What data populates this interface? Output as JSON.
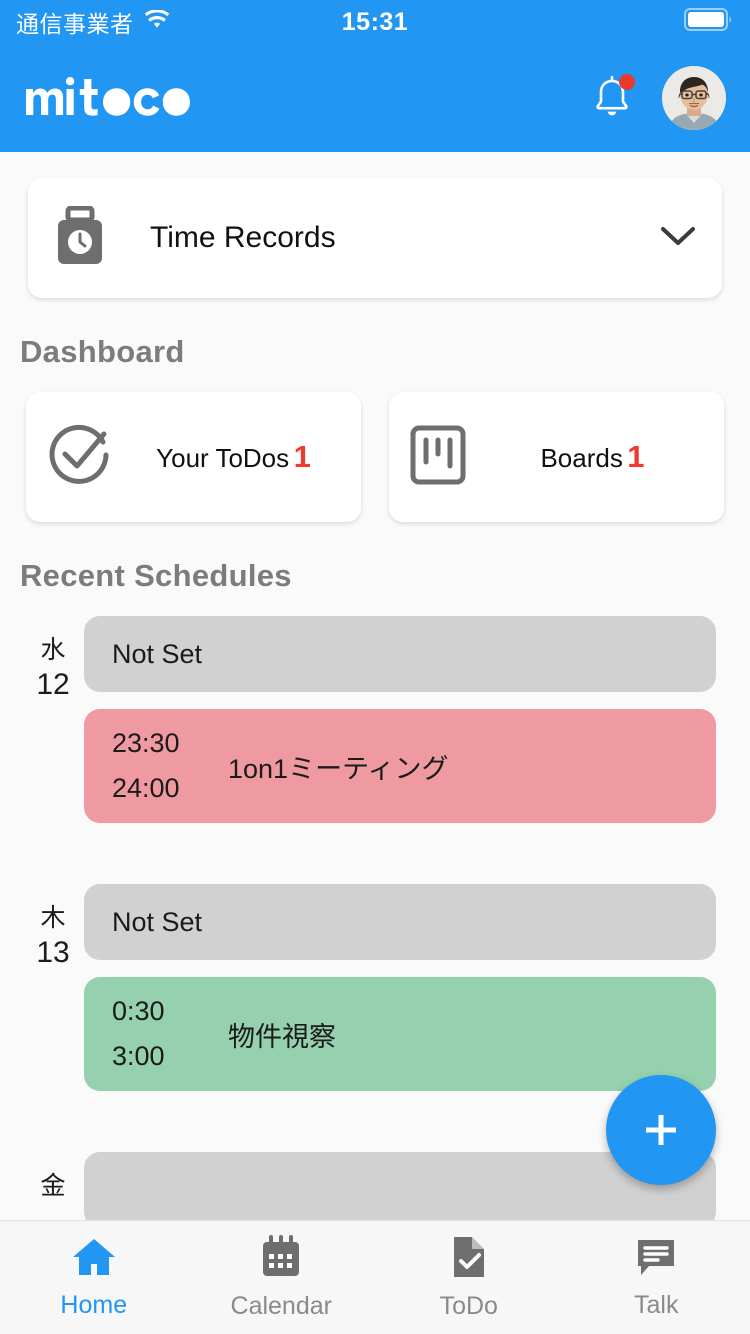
{
  "statusbar": {
    "carrier": "通信事業者",
    "time": "15:31",
    "wifi_icon": "wifi-icon",
    "battery_icon": "battery-full-icon"
  },
  "header": {
    "logo_text": "mitoco",
    "bell_icon": "bell-icon",
    "notification_dot": true,
    "avatar_icon": "user-avatar"
  },
  "time_records": {
    "icon": "punch-clock-icon",
    "title": "Time Records",
    "chevron_icon": "chevron-down-icon"
  },
  "dashboard": {
    "title": "Dashboard",
    "cards": [
      {
        "icon": "check-circle-icon",
        "label": "Your ToDos",
        "count": "1"
      },
      {
        "icon": "kanban-board-icon",
        "label": "Boards",
        "count": "1"
      }
    ]
  },
  "schedules": {
    "title": "Recent Schedules",
    "days": [
      {
        "dow": "水",
        "day": "12",
        "events": [
          {
            "kind": "notset",
            "label": "Not Set"
          },
          {
            "kind": "timed",
            "start": "23:30",
            "end": "24:00",
            "title": "1on1ミーティング",
            "color": "#ee9aa0"
          }
        ]
      },
      {
        "dow": "木",
        "day": "13",
        "events": [
          {
            "kind": "notset",
            "label": "Not Set"
          },
          {
            "kind": "timed",
            "start": "0:30",
            "end": "3:00",
            "title": "物件視察",
            "color": "#95d1ae"
          }
        ]
      },
      {
        "dow": "金",
        "day": "",
        "events": [
          {
            "kind": "notset",
            "label": ""
          }
        ]
      }
    ]
  },
  "fab": {
    "icon": "plus-icon",
    "label": "+"
  },
  "tabbar": {
    "tabs": [
      {
        "icon": "home-icon",
        "label": "Home",
        "active": true
      },
      {
        "icon": "calendar-icon",
        "label": "Calendar",
        "active": false
      },
      {
        "icon": "todo-doc-icon",
        "label": "ToDo",
        "active": false
      },
      {
        "icon": "talk-chat-icon",
        "label": "Talk",
        "active": false
      }
    ]
  },
  "colors": {
    "brand_blue": "#2196f3",
    "accent_red": "#ee3b2f",
    "event_pink": "#ee9aa0",
    "event_green": "#95d1ae",
    "event_gray": "#d1d1d1",
    "section_gray": "#7c7c7c"
  }
}
